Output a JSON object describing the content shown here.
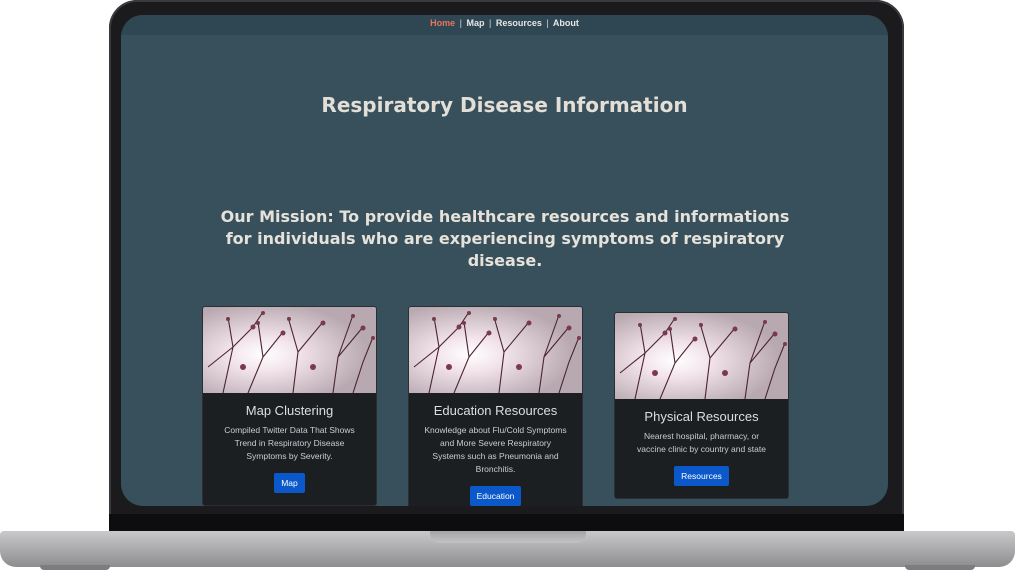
{
  "nav": {
    "items": [
      {
        "label": "Home",
        "active": true
      },
      {
        "label": "Map",
        "active": false
      },
      {
        "label": "Resources",
        "active": false
      },
      {
        "label": "About",
        "active": false
      }
    ],
    "separator": "|"
  },
  "hero": {
    "title": "Respiratory Disease Information"
  },
  "mission": {
    "text": "Our Mission: To provide healthcare resources and informations for individuals who are experiencing symptoms of respiratory disease."
  },
  "cards": [
    {
      "title": "Map Clustering",
      "text": "Compiled Twitter Data That Shows Trend in Respiratory Disease Symptoms by Severity.",
      "button": "Map"
    },
    {
      "title": "Education Resources",
      "text": "Knowledge about Flu/Cold Symptoms and More Severe Respiratory Systems such as Pneumonia and Bronchitis.",
      "button": "Education"
    },
    {
      "title": "Physical Resources",
      "text": "Nearest hospital, pharmacy, or vaccine clinic by country and state",
      "button": "Resources"
    }
  ],
  "colors": {
    "page_background": "#37505c",
    "navbar_background": "#2f4753",
    "nav_active": "#e8735e",
    "card_background": "#1c1f22",
    "button_primary": "#0a58ca"
  },
  "icons": {
    "card_image": "branches-photo"
  }
}
